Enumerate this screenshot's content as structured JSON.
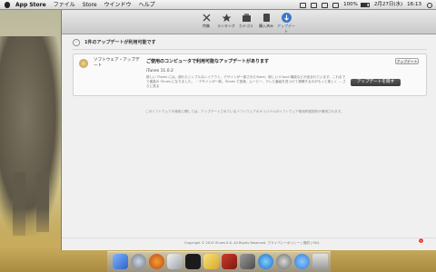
{
  "menubar": {
    "app_name": "App Store",
    "items": [
      "ファイル",
      "Store",
      "ウインドウ",
      "ヘルプ"
    ],
    "status_battery": "100%",
    "status_date": "2月27日(水)",
    "status_time": "16:13"
  },
  "toolbar": {
    "items": [
      "特集",
      "ランキング",
      "カテゴリ",
      "購入済み",
      "アップデート"
    ],
    "active_index": 4,
    "accent_color": "#3a78c8"
  },
  "content": {
    "back_icon": "chevron-left-icon",
    "updates_title": "1件のアップデートが利用可能です",
    "update": {
      "software_name": "ソフトウェア・アップデート",
      "headline": "ご使用のコンピュータで利用可能なアップデートがあります",
      "small_button": "アップデート",
      "version": "iTunes 11.0.2",
      "description": "新しい iTunes には、優れたシンプルなレイアウト、デザインが一新されたStore、新しい iCloud 機能などが含まれています。これまでで最高の iTunes になりました。 ・デザインが一新。iTunes で音楽、ムービー、テレビ番組を見つけて視聴するのがもっと楽しく ... さらに見る",
      "more_link": "さらに見る",
      "update_button": "アップデートを隠す"
    },
    "license_text": "このソフトウェアの使用に関しては、アップデートされているソフトウェアのオリジナルのソフトウェア使用許諾契約が適用されます。"
  },
  "footer": {
    "copyright": "Copyright © 2013 iTunes K.K. All Rights Reserved.  プライバシーポリシー | 規約 | FAQ"
  },
  "dock": {
    "icons": [
      "finder-icon",
      "launchpad-icon",
      "firefox-icon",
      "preview-icon",
      "terminal-icon",
      "stickies-icon",
      "photo-icon",
      "mission-control-icon",
      "safari-icon",
      "system-preferences-icon",
      "app-store-icon",
      "trash-icon"
    ]
  }
}
